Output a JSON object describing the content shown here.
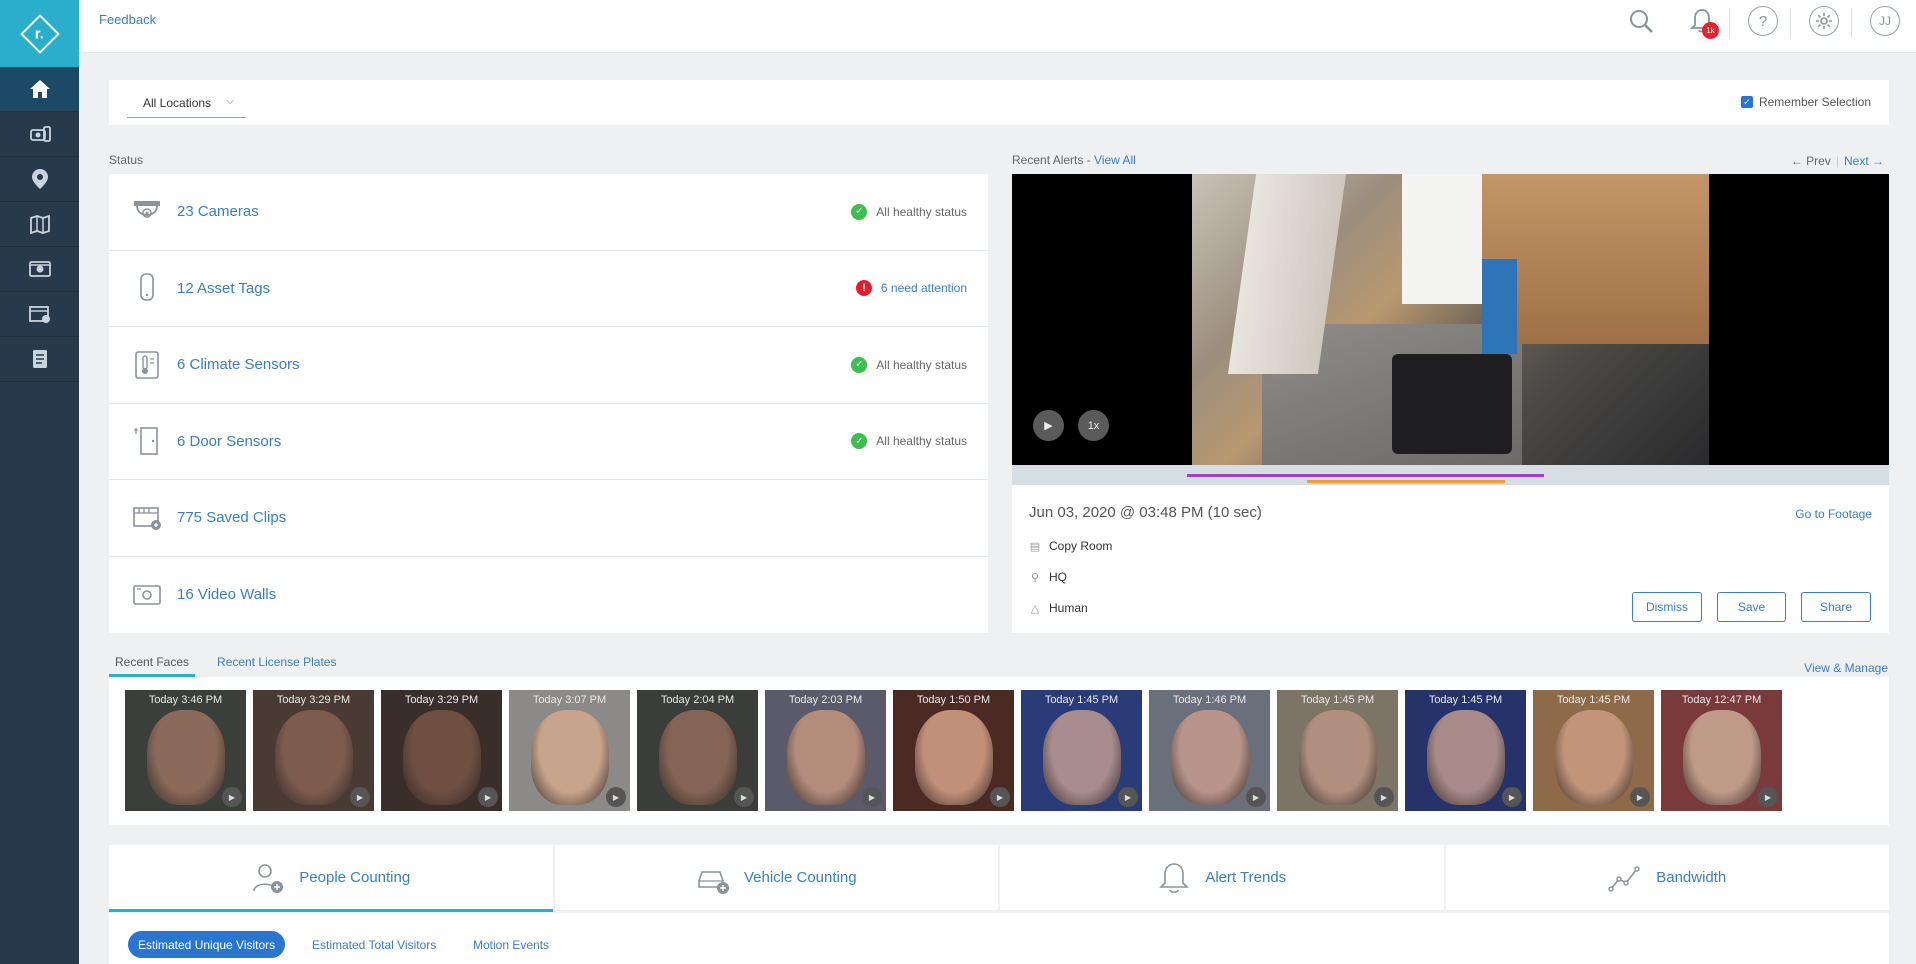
{
  "topbar": {
    "feedback_label": "Feedback",
    "notification_count": "1k",
    "help_glyph": "?",
    "user_initials": "JJ"
  },
  "sidebar": {
    "logo_glyph": "r.",
    "items": [
      {
        "icon": "home-icon"
      },
      {
        "icon": "devices-icon"
      },
      {
        "icon": "location-pin-icon"
      },
      {
        "icon": "map-icon"
      },
      {
        "icon": "video-wall-icon"
      },
      {
        "icon": "clips-icon"
      },
      {
        "icon": "reports-icon"
      }
    ]
  },
  "location": {
    "selected": "All Locations",
    "remember_label": "Remember Selection",
    "remember_checked": true
  },
  "status": {
    "label": "Status",
    "rows": [
      {
        "name": "23 Cameras",
        "state": "All healthy status",
        "type": "ok"
      },
      {
        "name": "12 Asset Tags",
        "state": "6 need attention",
        "type": "attention"
      },
      {
        "name": "6 Climate Sensors",
        "state": "All healthy status",
        "type": "ok"
      },
      {
        "name": "6 Door Sensors",
        "state": "All healthy status",
        "type": "ok"
      },
      {
        "name": "775 Saved Clips",
        "state": "",
        "type": "none"
      },
      {
        "name": "16 Video Walls",
        "state": "",
        "type": "none"
      }
    ]
  },
  "alerts": {
    "label": "Recent Alerts - ",
    "view_all": "View All",
    "prev": "← Prev",
    "next": "Next →",
    "speed": "1x",
    "timestamp": "Jun 03, 2020 @ 03:48 PM (10 sec)",
    "goto_label": "Go to Footage",
    "camera": "Copy Room",
    "location": "HQ",
    "type": "Human",
    "dismiss": "Dismiss",
    "save": "Save",
    "share": "Share",
    "accent_purple": "#a03fd6",
    "accent_orange": "#f0a030"
  },
  "faces": {
    "tabs": [
      "Recent Faces",
      "Recent License Plates"
    ],
    "view_manage": "View & Manage",
    "items": [
      {
        "time": "Today 3:46 PM",
        "bg": "#3b3f3a",
        "skin": "#8b6a5a"
      },
      {
        "time": "Today 3:29 PM",
        "bg": "#4a3a34",
        "skin": "#7d5c4d"
      },
      {
        "time": "Today 3:29 PM",
        "bg": "#3a2e2a",
        "skin": "#6e4f42"
      },
      {
        "time": "Today 3:07 PM",
        "bg": "#8c8a88",
        "skin": "#c9a48c"
      },
      {
        "time": "Today 2:04 PM",
        "bg": "#3a3d3a",
        "skin": "#846454"
      },
      {
        "time": "Today 2:03 PM",
        "bg": "#5b5a6a",
        "skin": "#b48c7c"
      },
      {
        "time": "Today 1:50 PM",
        "bg": "#4a2a22",
        "skin": "#c29078"
      },
      {
        "time": "Today 1:45 PM",
        "bg": "#2a3b7a",
        "skin": "#a98c8e"
      },
      {
        "time": "Today 1:46 PM",
        "bg": "#6a6f7c",
        "skin": "#b8948a"
      },
      {
        "time": "Today 1:45 PM",
        "bg": "#7c7464",
        "skin": "#b18f7f"
      },
      {
        "time": "Today 1:45 PM",
        "bg": "#25336a",
        "skin": "#a88a88"
      },
      {
        "time": "Today 1:45 PM",
        "bg": "#8e6a48",
        "skin": "#c2947a"
      },
      {
        "time": "Today 12:47 PM",
        "bg": "#7a3a3c",
        "skin": "#c09a88"
      }
    ]
  },
  "analytics": {
    "tabs": [
      "People Counting",
      "Vehicle Counting",
      "Alert Trends",
      "Bandwidth"
    ],
    "subtabs": [
      "Estimated Unique Visitors",
      "Estimated Total Visitors",
      "Motion Events"
    ]
  }
}
